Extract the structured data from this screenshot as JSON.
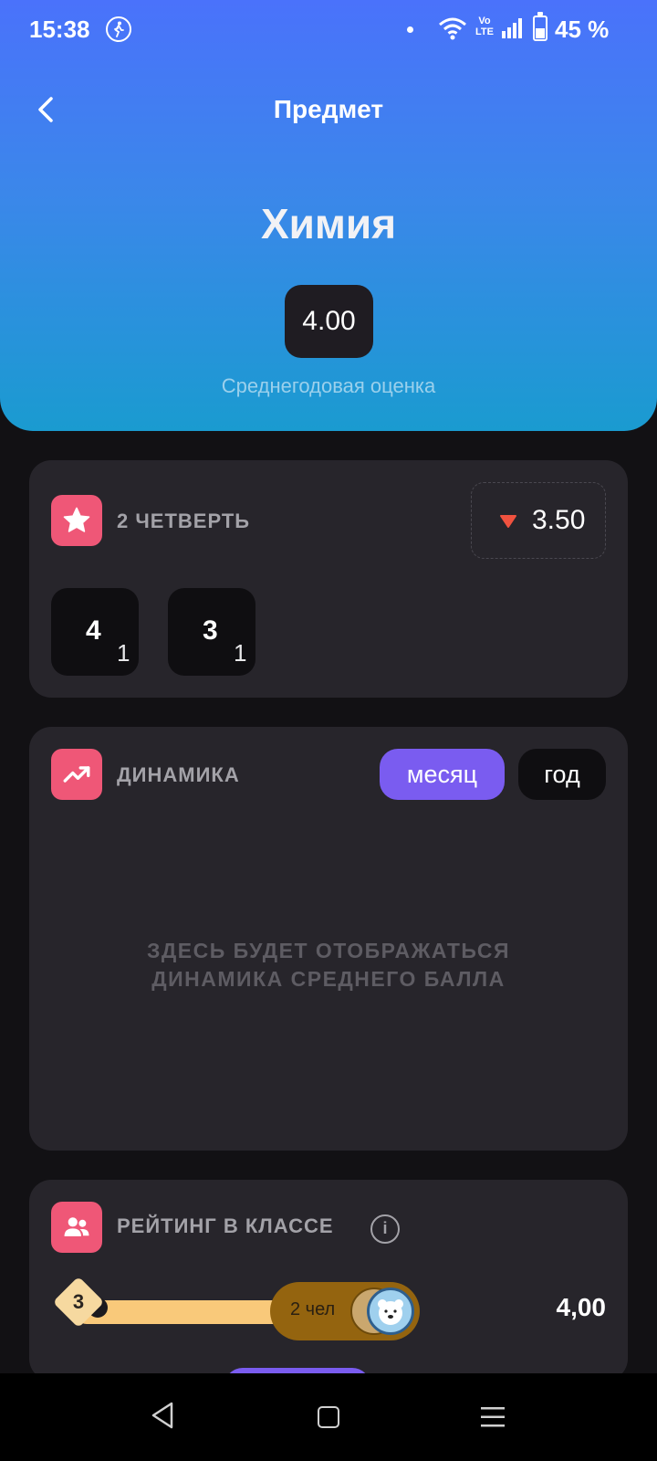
{
  "status_bar": {
    "time": "15:38",
    "volte_top": "Vo",
    "volte_bottom": "LTE",
    "battery_percent": "45 %"
  },
  "header": {
    "title": "Предмет",
    "subject": "Химия",
    "average_grade": "4.00",
    "average_caption": "Среднегодовая оценка"
  },
  "quarter_card": {
    "title": "2 ЧЕТВЕРТЬ",
    "quarter_average": "3.50",
    "trend_color": "#f0523f",
    "grades": [
      {
        "grade": "4",
        "count": "1"
      },
      {
        "grade": "3",
        "count": "1"
      }
    ]
  },
  "dynamics_card": {
    "title": "ДИНАМИКА",
    "period_options": [
      "месяц",
      "год"
    ],
    "selected_period": "месяц",
    "empty_line1": "ЗДЕСЬ БУДЕТ ОТОБРАЖАТЬСЯ",
    "empty_line2": "ДИНАМИКА СРЕДНЕГО БАЛЛА"
  },
  "rating_card": {
    "title": "РЕЙТИНГ В КЛАССЕ",
    "info_symbol": "i",
    "rank": "3",
    "people_count": "2 чел",
    "score": "4,00"
  },
  "colors": {
    "accent_pink": "#ef5777",
    "accent_purple": "#7a5cf0",
    "header_top": "#4a72fb",
    "header_bottom": "#1a9bd0"
  },
  "icons": [
    "back-arrow-icon",
    "star-icon",
    "trend-up-icon",
    "people-icon",
    "info-icon",
    "nav-back-icon",
    "nav-home-icon",
    "nav-menu-icon"
  ]
}
